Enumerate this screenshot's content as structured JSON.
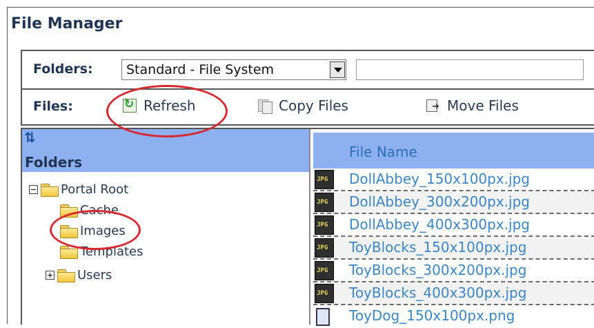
{
  "window": {
    "title": "File Manager"
  },
  "toolbar": {
    "folders_label": "Folders:",
    "folder_source": "Standard - File System",
    "files_label": "Files:",
    "refresh_label": "Refresh",
    "copy_label": "Copy Files",
    "move_label": "Move Files"
  },
  "folders_panel": {
    "heading": "Folders",
    "tree": [
      {
        "label": "Portal Root",
        "toggle": "minus"
      },
      {
        "label": "Cache"
      },
      {
        "label": "Images"
      },
      {
        "label": "Templates"
      },
      {
        "label": "Users",
        "toggle": "plus"
      }
    ]
  },
  "files_panel": {
    "column_header": "File Name",
    "files": [
      {
        "name": "DollAbbey_150x100px.jpg",
        "icon": "jpg-file-icon"
      },
      {
        "name": "DollAbbey_300x200px.jpg",
        "icon": "jpg-file-icon"
      },
      {
        "name": "DollAbbey_400x300px.jpg",
        "icon": "jpg-file-icon"
      },
      {
        "name": "ToyBlocks_150x100px.jpg",
        "icon": "jpg-file-icon"
      },
      {
        "name": "ToyBlocks_300x200px.jpg",
        "icon": "jpg-file-icon"
      },
      {
        "name": "ToyBlocks_400x300px.jpg",
        "icon": "jpg-file-icon"
      },
      {
        "name": "ToyDog_150x100px.png",
        "icon": "png-file-icon"
      }
    ]
  },
  "colors": {
    "header_bg": "#8fb0f0",
    "link": "#3a86c8",
    "highlight": "#d9272e"
  }
}
